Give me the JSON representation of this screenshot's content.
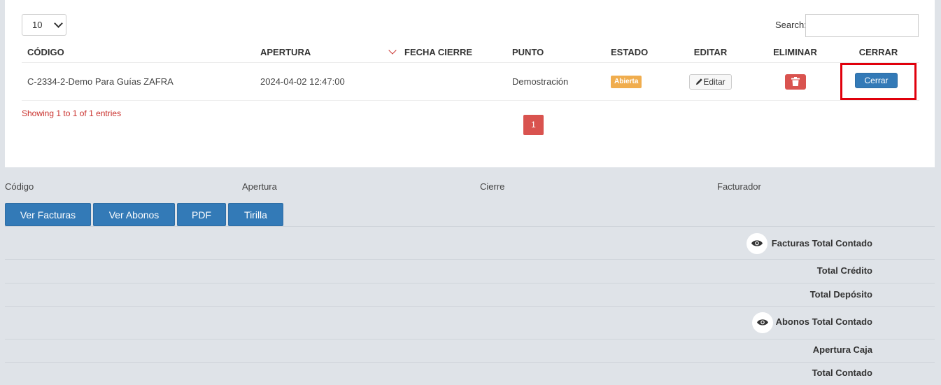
{
  "table_controls": {
    "page_length": "10",
    "search_label": "Search:",
    "search_value": ""
  },
  "columns": {
    "codigo": "CÓDIGO",
    "apertura": "APERTURA",
    "fecha_cierre": "FECHA CIERRE",
    "punto": "PUNTO",
    "estado": "ESTADO",
    "editar": "EDITAR",
    "eliminar": "ELIMINAR",
    "cerrar": "CERRAR"
  },
  "rows": [
    {
      "codigo": "C-2334-2-Demo Para Guías ZAFRA",
      "apertura": "2024-04-02 12:47:00",
      "fecha_cierre": "",
      "punto": "Demostración",
      "estado": "Abierta",
      "editar_label": "Editar",
      "cerrar_label": "Cerrar"
    }
  ],
  "pagination": {
    "info": "Showing 1 to 1 of 1 entries",
    "current_page": "1"
  },
  "summary": {
    "codigo_label": "Código",
    "apertura_label": "Apertura",
    "cierre_label": "Cierre",
    "facturador_label": "Facturador"
  },
  "actions": {
    "ver_facturas": "Ver Facturas",
    "ver_abonos": "Ver Abonos",
    "pdf": "PDF",
    "tirilla": "Tirilla"
  },
  "totals": {
    "facturas_total_contado": "Facturas Total Contado",
    "total_credito": "Total Crédito",
    "total_deposito": "Total Depósito",
    "abonos_total_contado": "Abonos Total Contado",
    "apertura_caja": "Apertura Caja",
    "total_contado": "Total Contado"
  },
  "colors": {
    "primary": "#337ab7",
    "danger": "#d9534f",
    "warning": "#f0ad4e",
    "highlight": "#e0000c"
  }
}
